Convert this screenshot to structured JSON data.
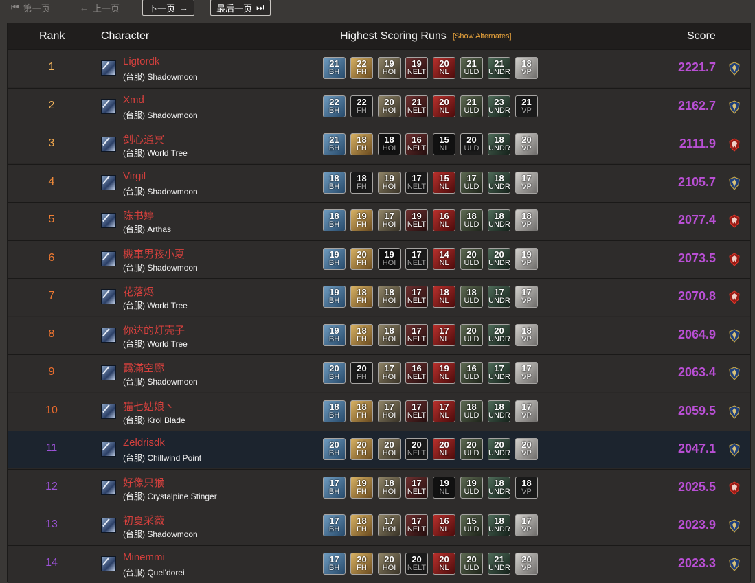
{
  "pager": {
    "first": "第一页",
    "prev": "上一页",
    "next": "下一页",
    "last": "最后一页"
  },
  "header": {
    "rank": "Rank",
    "character": "Character",
    "runs": "Highest Scoring Runs",
    "show_alternates": "[Show Alternates]",
    "score": "Score"
  },
  "dungeons": [
    "BH",
    "FH",
    "HOI",
    "NELT",
    "NL",
    "ULD",
    "UNDR",
    "VP"
  ],
  "rows": [
    {
      "rank": "1",
      "name": "Ligtordk",
      "realm": "(台服) Shadowmoon",
      "runs": [
        "21",
        "22",
        "19",
        "19",
        "20",
        "21",
        "21",
        "18"
      ],
      "score": "2221.7",
      "faction": "alliance"
    },
    {
      "rank": "2",
      "name": "Xmd",
      "realm": "(台服) Shadowmoon",
      "runs": [
        "22",
        "22",
        "20",
        "21",
        "20",
        "21",
        "23",
        "21"
      ],
      "score": "2162.7",
      "faction": "alliance"
    },
    {
      "rank": "3",
      "name": "剑心通冥",
      "realm": "(台服) World Tree",
      "runs": [
        "21",
        "18",
        "18",
        "16",
        "15",
        "20",
        "18",
        "20"
      ],
      "score": "2111.9",
      "faction": "horde"
    },
    {
      "rank": "4",
      "name": "Virgil",
      "realm": "(台服) Shadowmoon",
      "runs": [
        "18",
        "18",
        "19",
        "17",
        "15",
        "17",
        "18",
        "17"
      ],
      "score": "2105.7",
      "faction": "alliance"
    },
    {
      "rank": "5",
      "name": "陈书婷",
      "realm": "(台服) Arthas",
      "runs": [
        "18",
        "19",
        "17",
        "19",
        "16",
        "18",
        "18",
        "18"
      ],
      "score": "2077.4",
      "faction": "horde"
    },
    {
      "rank": "6",
      "name": "機車男孩小夏",
      "realm": "(台服) Shadowmoon",
      "runs": [
        "19",
        "20",
        "19",
        "17",
        "14",
        "20",
        "20",
        "19"
      ],
      "score": "2073.5",
      "faction": "horde"
    },
    {
      "rank": "7",
      "name": "花落烬",
      "realm": "(台服) World Tree",
      "runs": [
        "19",
        "18",
        "18",
        "17",
        "18",
        "18",
        "17",
        "17"
      ],
      "score": "2070.8",
      "faction": "horde"
    },
    {
      "rank": "8",
      "name": "你达的灯壳子",
      "realm": "(台服) World Tree",
      "runs": [
        "19",
        "18",
        "18",
        "17",
        "17",
        "20",
        "20",
        "18"
      ],
      "score": "2064.9",
      "faction": "alliance"
    },
    {
      "rank": "9",
      "name": "靄滿空廊",
      "realm": "(台服) Shadowmoon",
      "runs": [
        "20",
        "20",
        "17",
        "16",
        "19",
        "16",
        "17",
        "17"
      ],
      "score": "2063.4",
      "faction": "alliance"
    },
    {
      "rank": "10",
      "name": "猫七姑娘丶",
      "realm": "(台服) Krol Blade",
      "runs": [
        "18",
        "18",
        "17",
        "17",
        "17",
        "18",
        "18",
        "17"
      ],
      "score": "2059.5",
      "faction": "alliance"
    },
    {
      "rank": "11",
      "name": "Zeldrisdk",
      "realm": "(台服) Chillwind Point",
      "runs": [
        "20",
        "20",
        "20",
        "20",
        "20",
        "20",
        "20",
        "20"
      ],
      "score": "2047.1",
      "faction": "alliance"
    },
    {
      "rank": "12",
      "name": "好像只猴",
      "realm": "(台服) Crystalpine Stinger",
      "runs": [
        "17",
        "19",
        "18",
        "17",
        "19",
        "19",
        "18",
        "18"
      ],
      "score": "2025.5",
      "faction": "horde"
    },
    {
      "rank": "13",
      "name": "初夏采薇",
      "realm": "(台服) Shadowmoon",
      "runs": [
        "17",
        "18",
        "17",
        "17",
        "16",
        "15",
        "18",
        "17"
      ],
      "score": "2023.9",
      "faction": "alliance"
    },
    {
      "rank": "14",
      "name": "Minemmi",
      "realm": "(台服) Quel'dorei",
      "runs": [
        "17",
        "20",
        "20",
        "20",
        "20",
        "20",
        "21",
        "20"
      ],
      "score": "2023.3",
      "faction": "alliance"
    }
  ]
}
